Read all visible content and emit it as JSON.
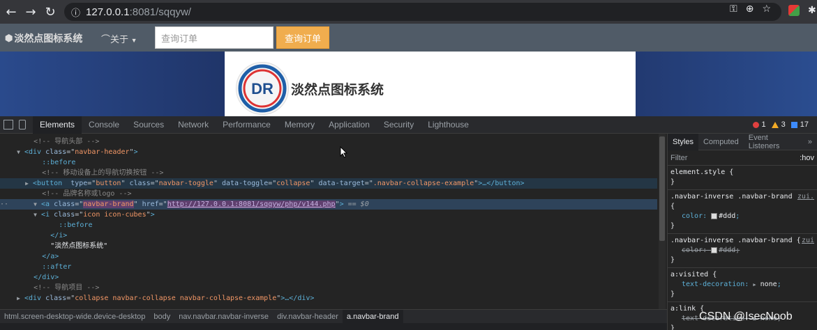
{
  "browser": {
    "url_host": "127.0.0.1",
    "url_rest": ":8081/sqqyw/"
  },
  "site": {
    "brand": "淡然点图标系统",
    "about": "关于",
    "search_placeholder": "查询订单",
    "search_button": "查询订单",
    "logo_title": "淡然点图标系统",
    "logo_letters": "DR"
  },
  "devtools": {
    "tabs": [
      "Elements",
      "Console",
      "Sources",
      "Network",
      "Performance",
      "Memory",
      "Application",
      "Security",
      "Lighthouse"
    ],
    "active_tab": "Elements",
    "errors": "1",
    "warnings": "3",
    "messages": "17",
    "dom_lines": [
      {
        "indent": 4,
        "kind": "comment",
        "text": "<!-- 导航头部 -->"
      },
      {
        "indent": 3,
        "kind": "open",
        "arrow": "▼",
        "tag": "div",
        "attrs": [
          [
            "class",
            "navbar-header"
          ]
        ],
        "close": ">"
      },
      {
        "indent": 5,
        "kind": "pseudo",
        "text": "::before"
      },
      {
        "indent": 5,
        "kind": "comment",
        "text": "<!-- 移动设备上的导航切换按钮 -->"
      },
      {
        "indent": 4,
        "kind": "button",
        "arrow": "▶",
        "text_pre": "<button ",
        "attrs": [
          [
            "type",
            "button"
          ],
          [
            "class",
            "navbar-toggle"
          ],
          [
            "data-toggle",
            "collapse"
          ],
          [
            "data-target",
            ".navbar-collapse-example"
          ]
        ],
        "text_post": ">…</button>"
      },
      {
        "indent": 5,
        "kind": "comment",
        "text": "<!-- 品牌名称或logo -->"
      },
      {
        "indent": 4,
        "kind": "selected",
        "arrow": "▼",
        "class_val": "navbar-brand",
        "href": "http://127.0.0.1:8081/sqqyw/php/v144.php",
        "suffix": " == $0"
      },
      {
        "indent": 5,
        "kind": "open",
        "arrow": "▼",
        "tag": "i",
        "attrs": [
          [
            "class",
            "icon icon-cubes"
          ]
        ],
        "close": ">"
      },
      {
        "indent": 7,
        "kind": "pseudo",
        "text": "::before"
      },
      {
        "indent": 6,
        "kind": "close",
        "text": "</i>"
      },
      {
        "indent": 6,
        "kind": "text",
        "text": "\"淡然点图标系统\""
      },
      {
        "indent": 5,
        "kind": "close",
        "text": "</a>"
      },
      {
        "indent": 5,
        "kind": "pseudo",
        "text": "::after"
      },
      {
        "indent": 4,
        "kind": "close",
        "text": "</div>"
      },
      {
        "indent": 4,
        "kind": "comment",
        "text": "<!-- 导航项目 -->"
      },
      {
        "indent": 3,
        "kind": "collapsed",
        "arrow": "▶",
        "tag": "div",
        "attrs": [
          [
            "class",
            "collapse navbar-collapse navbar-collapse-example"
          ]
        ],
        "close": ">…</div>"
      }
    ],
    "breadcrumbs": [
      "html.screen-desktop-wide.device-desktop",
      "body",
      "nav.navbar.navbar-inverse",
      "div.navbar-header",
      "a.navbar-brand"
    ],
    "styles_tabs": [
      "Styles",
      "Computed",
      "Event Listeners"
    ],
    "filter_placeholder": "Filter",
    "hov_label": ":hov",
    "rules": [
      {
        "selector": "element.style {",
        "props": [],
        "close": "}"
      },
      {
        "selector": ".navbar-inverse .navbar-brand",
        "source": "zui.",
        "open": "{",
        "props": [
          {
            "name": "color",
            "value": "#ddd",
            "swatch": "#dddddd",
            "strike": false
          }
        ],
        "close": "}"
      },
      {
        "selector": ".navbar-inverse .navbar-brand {",
        "source": "zui",
        "props": [
          {
            "name": "color",
            "value": "#ddd",
            "swatch": "#dddddd",
            "strike": true
          }
        ],
        "close": "}"
      },
      {
        "selector": "a:visited {",
        "props": [
          {
            "name": "text-decoration",
            "value": "none",
            "arrow": true,
            "strike": false
          }
        ],
        "close": "}"
      },
      {
        "selector": "a:link {",
        "props": [
          {
            "name": "text-decoration",
            "value": "none",
            "arrow": true,
            "strike": true
          }
        ],
        "close": "}"
      }
    ]
  },
  "watermark": "CSDN @IsecNoob"
}
